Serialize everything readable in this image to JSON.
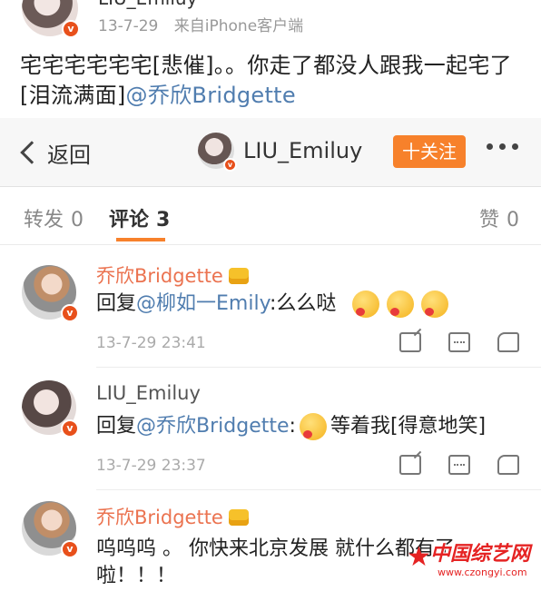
{
  "post": {
    "author_partial": "LIU_Emiluy",
    "date": "13-7-29",
    "source": "来自iPhone客户端",
    "text_before": "宅宅宅宅宅宅[悲催]。。你走了都没人跟我一起宅了[泪流满面]",
    "mention": "@乔欣Bridgette"
  },
  "navbar": {
    "back_label": "返回",
    "username": "LIU_Emiluy",
    "follow_label": "十关注"
  },
  "tabs": {
    "repost": {
      "label": "转发",
      "count": "0"
    },
    "comments": {
      "label": "评论",
      "count": "3"
    },
    "likes": {
      "label": "赞",
      "count": "0"
    }
  },
  "comments": [
    {
      "username": "乔欣Bridgette",
      "reply_prefix": "回复",
      "mention": "@柳如一Emily",
      "text": ":么么哒",
      "emoji_count": 3,
      "time": "13-7-29 23:41"
    },
    {
      "username": "LIU_Emiluy",
      "reply_prefix": "回复",
      "mention": "@乔欣Bridgette",
      "text_before": ":",
      "text_after": "等着我[得意地笑]",
      "time": "13-7-29 23:37"
    },
    {
      "username": "乔欣Bridgette",
      "line1": "呜呜呜 。 你快来北京发展 就什么都有了",
      "line2": "啦！！！"
    }
  ],
  "watermark": {
    "title": "中国综艺网",
    "url": "www.czongyi.com"
  },
  "colors": {
    "accent": "#f7812b",
    "mention": "#507daf",
    "vip_name": "#eb7350"
  }
}
